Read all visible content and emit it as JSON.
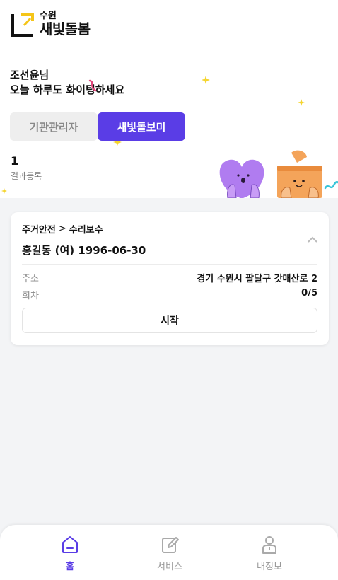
{
  "logo": {
    "small": "수원",
    "big": "새빛돌봄"
  },
  "greeting": {
    "name": "조선윤님",
    "message": "오늘 하루도 화이팅하세요"
  },
  "segment": {
    "tab1": "기관관리자",
    "tab2": "새빛돌보미",
    "active": "tab2"
  },
  "stats": {
    "count": "1",
    "label": "결과등록"
  },
  "card": {
    "category": "주거안전",
    "separator": ">",
    "subcategory": "수리보수",
    "person": "홍길동 (여) 1996-06-30",
    "rows": [
      {
        "key": "주소",
        "value": "경기 수원시 팔달구 갓매산로 2"
      },
      {
        "key": "회차",
        "value": "0/5"
      }
    ],
    "start_label": "시작"
  },
  "tabbar": {
    "tabs": [
      {
        "label": "홈",
        "icon": "home-icon",
        "active": true
      },
      {
        "label": "서비스",
        "icon": "edit-icon",
        "active": false
      },
      {
        "label": "내정보",
        "icon": "user-icon",
        "active": false
      }
    ]
  },
  "colors": {
    "accent": "#5a3de6",
    "yellow": "#f5c518",
    "purple_char": "#b07cf0",
    "orange_char": "#f4a45a"
  }
}
